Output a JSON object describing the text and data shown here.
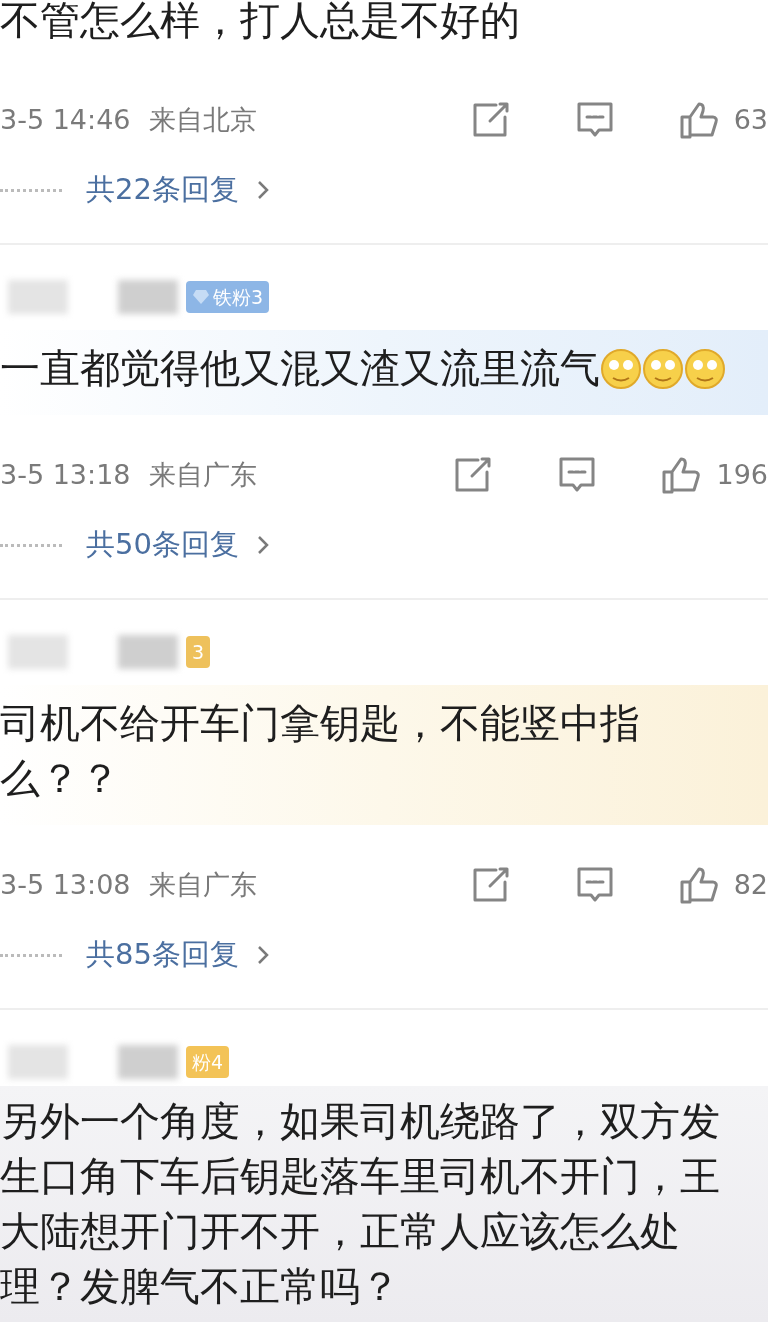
{
  "comments": [
    {
      "text": "不管怎么样，打人总是不好的",
      "time": "3-5 14:46",
      "location": "来自北京",
      "likes": "63",
      "replies": "共22条回复"
    },
    {
      "user": {
        "badge": {
          "text": "铁粉3",
          "color": "#8db6e6",
          "kind": "diamond"
        }
      },
      "kind": "iceblue",
      "emojis": [
        {
          "kind": "face"
        },
        {
          "kind": "face"
        },
        {
          "kind": "face"
        }
      ],
      "text": "一直都觉得他又混又渣又流里流气",
      "time": "3-5 13:18",
      "location": "来自广东",
      "likes": "196",
      "replies": "共50条回复"
    },
    {
      "user": {
        "badge": {
          "text": "3",
          "color": "#eec15c",
          "kind": "plain"
        }
      },
      "kind": "golden",
      "text": "司机不给开车门拿钥匙，不能竖中指么？？",
      "time": "3-5 13:08",
      "location": "来自广东",
      "likes": "82",
      "replies": "共85条回复"
    },
    {
      "user": {
        "badge": {
          "text": "粉4",
          "color": "#f3c357",
          "kind": "plain"
        }
      },
      "kind": "grey",
      "text": "另外一个角度，如果司机绕路了，双方发生口角下车后钥匙落车里司机不开门，王大陆想开门开不开，正常人应该怎么处理？发脾气不正常吗？"
    }
  ]
}
